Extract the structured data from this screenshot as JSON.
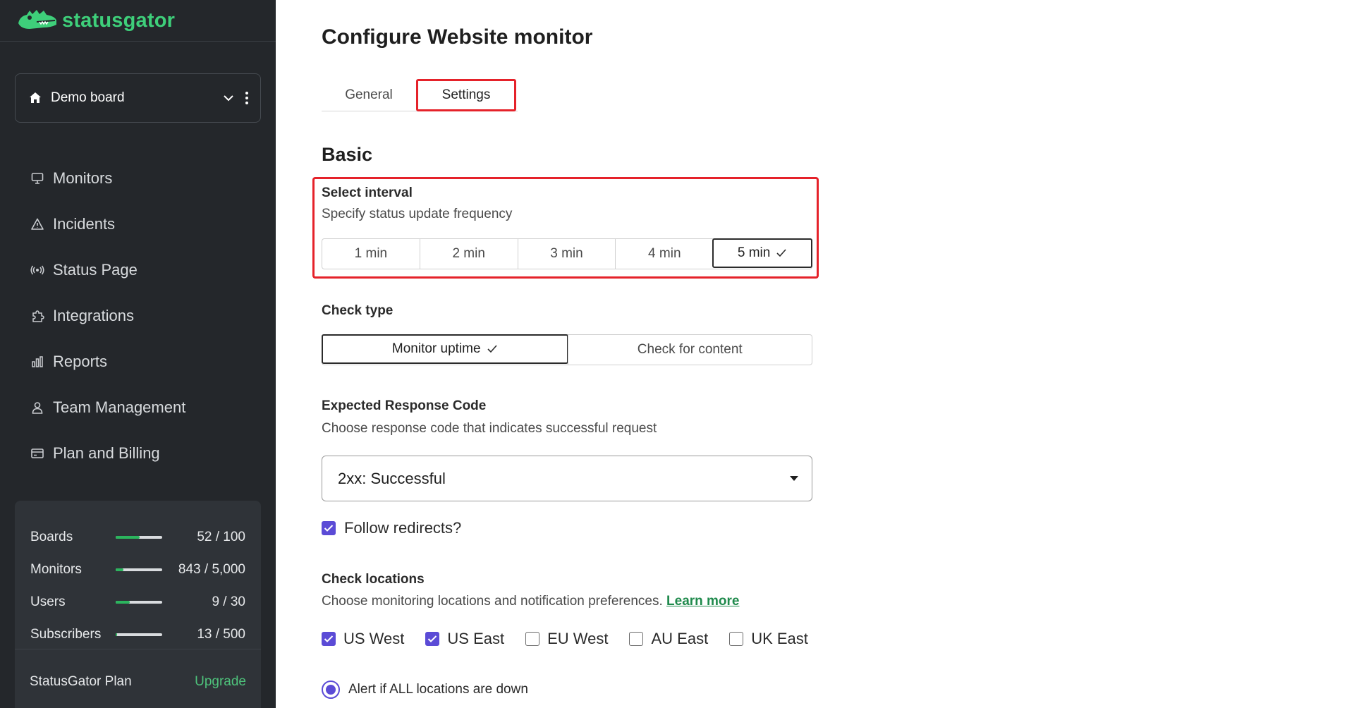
{
  "brand": {
    "name": "statusgator",
    "logo_icon": "gator-logo-icon",
    "accent": "#3ecf7a"
  },
  "board_selector": {
    "name": "Demo board"
  },
  "sidebar": {
    "items": [
      {
        "label": "Monitors",
        "icon": "monitor-icon"
      },
      {
        "label": "Incidents",
        "icon": "warning-icon"
      },
      {
        "label": "Status Page",
        "icon": "broadcast-icon"
      },
      {
        "label": "Integrations",
        "icon": "puzzle-icon"
      },
      {
        "label": "Reports",
        "icon": "bar-chart-icon"
      },
      {
        "label": "Team Management",
        "icon": "user-icon"
      },
      {
        "label": "Plan and Billing",
        "icon": "credit-card-icon"
      }
    ]
  },
  "usage": [
    {
      "label": "Boards",
      "count": "52 / 100",
      "fraction": 0.52
    },
    {
      "label": "Monitors",
      "count": "843 / 5,000",
      "fraction": 0.17
    },
    {
      "label": "Users",
      "count": "9 / 30",
      "fraction": 0.3
    },
    {
      "label": "Subscribers",
      "count": "13 / 500",
      "fraction": 0.03
    }
  ],
  "plan": {
    "name": "StatusGator Plan",
    "upgrade_label": "Upgrade"
  },
  "main": {
    "title": "Configure Website monitor",
    "tabs": [
      {
        "label": "General",
        "active": false
      },
      {
        "label": "Settings",
        "active": true
      }
    ],
    "section_title": "Basic",
    "interval": {
      "label": "Select interval",
      "help": "Specify status update frequency",
      "options": [
        "1 min",
        "2 min",
        "3 min",
        "4 min",
        "5 min"
      ],
      "selected": "5 min"
    },
    "check_type": {
      "label": "Check type",
      "options": [
        "Monitor uptime",
        "Check for content"
      ],
      "selected": "Monitor uptime"
    },
    "response_code": {
      "label": "Expected Response Code",
      "help": "Choose response code that indicates successful request",
      "value": "2xx: Successful"
    },
    "follow_redirects": {
      "label": "Follow redirects?",
      "checked": true
    },
    "locations": {
      "label": "Check locations",
      "help": "Choose monitoring locations and notification preferences.",
      "learn_more": "Learn more",
      "items": [
        {
          "label": "US West",
          "checked": true
        },
        {
          "label": "US East",
          "checked": true
        },
        {
          "label": "EU West",
          "checked": false
        },
        {
          "label": "AU East",
          "checked": false
        },
        {
          "label": "UK East",
          "checked": false
        }
      ]
    },
    "alert_option": {
      "label": "Alert if ALL locations are down",
      "selected": true
    }
  },
  "colors": {
    "sidebar_bg": "#24272b",
    "highlight": "#e5222a",
    "checkbox": "#5b4bd6",
    "link": "#1f8a4c"
  }
}
